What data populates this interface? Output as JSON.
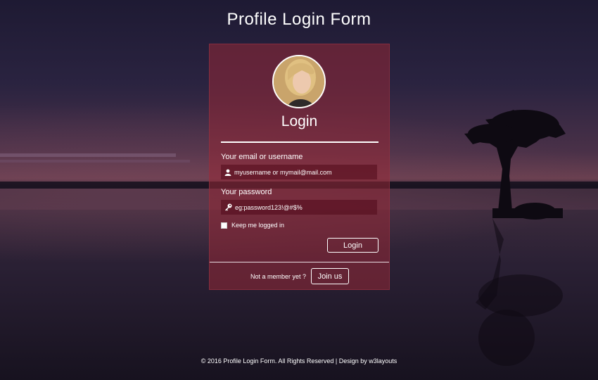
{
  "page": {
    "title": "Profile Login Form"
  },
  "login_card": {
    "title": "Login",
    "email_field": {
      "label": "Your email or username",
      "placeholder": "myusername or mymail@mail.com"
    },
    "password_field": {
      "label": "Your password",
      "placeholder": "eg:password123!@#$%"
    },
    "remember_label": "Keep me logged in",
    "login_button": "Login",
    "member_text": "Not a member yet ?",
    "join_button": "Join us"
  },
  "footer": {
    "text": "© 2016 Profile Login Form. All Rights Reserved | Design by w3layouts"
  },
  "colors": {
    "card": "#962837",
    "field": "#500a19",
    "text": "#ffffff"
  },
  "icons": [
    "user-icon",
    "key-icon"
  ]
}
